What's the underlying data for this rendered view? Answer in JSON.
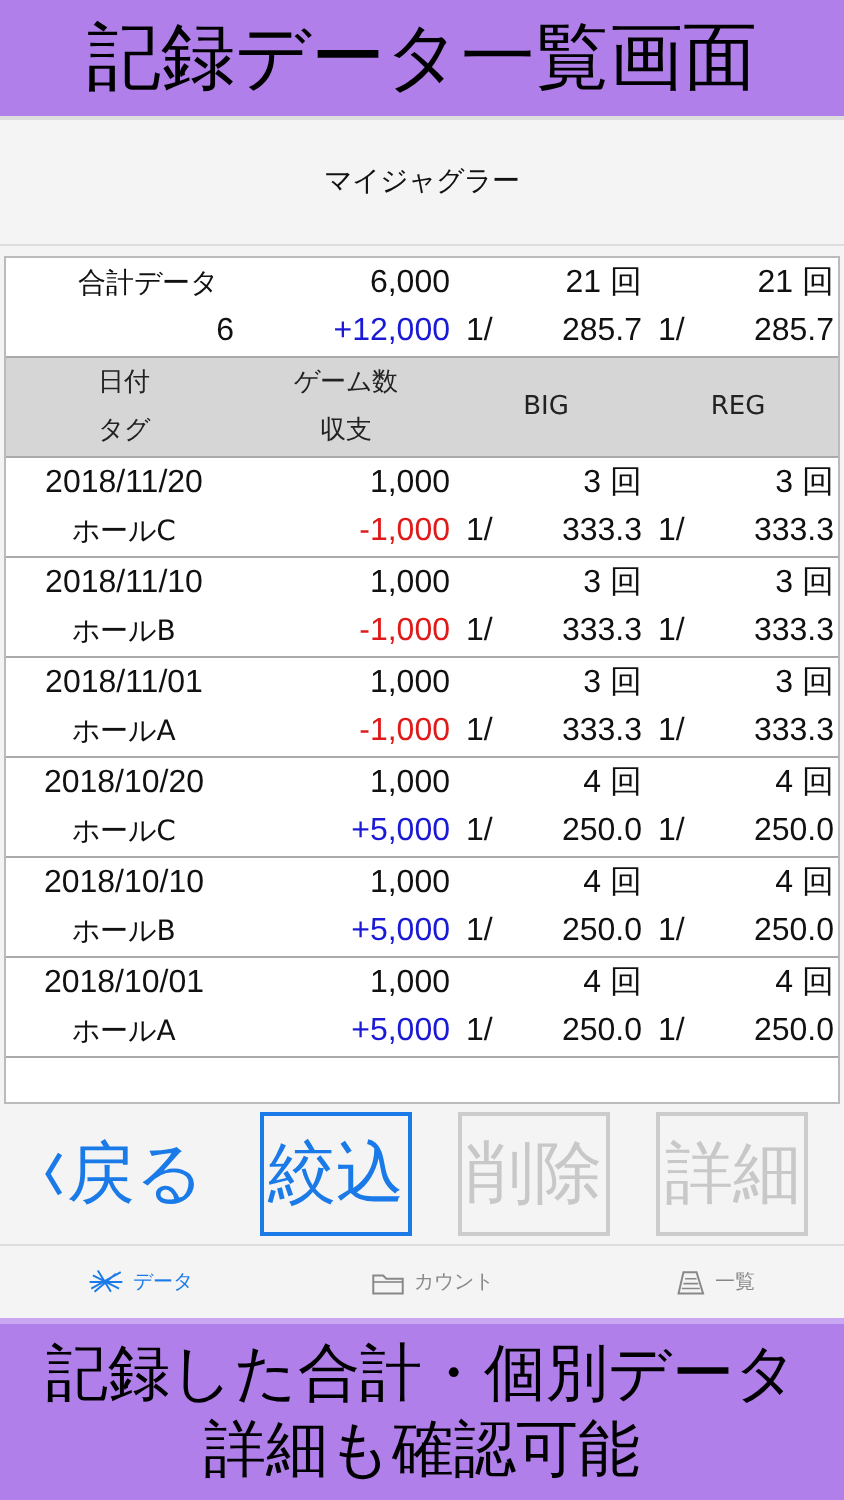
{
  "top_banner": "記録データ一覧画面",
  "nav": {
    "title": "マイジャグラー"
  },
  "summary": {
    "label": "合計データ",
    "count": "6",
    "games": "6,000",
    "balance": "+12,000",
    "color": "#1a1ad6",
    "big": {
      "count": "21 回",
      "prefix": "1/",
      "rate": "285.7"
    },
    "reg": {
      "count": "21 回",
      "prefix": "1/",
      "rate": "285.7"
    }
  },
  "columns": [
    {
      "top": "日付",
      "bottom": "タグ"
    },
    {
      "top": "ゲーム数",
      "bottom": "収支"
    },
    {
      "top": "BIG"
    },
    {
      "top": "REG"
    }
  ],
  "rows": [
    {
      "date": "2018/11/20",
      "tag": "ホールC",
      "games": "1,000",
      "balance": "-1,000",
      "color": "#e01a1a",
      "big": {
        "count": "3 回",
        "prefix": "1/",
        "rate": "333.3"
      },
      "reg": {
        "count": "3 回",
        "prefix": "1/",
        "rate": "333.3"
      }
    },
    {
      "date": "2018/11/10",
      "tag": "ホールB",
      "games": "1,000",
      "balance": "-1,000",
      "color": "#e01a1a",
      "big": {
        "count": "3 回",
        "prefix": "1/",
        "rate": "333.3"
      },
      "reg": {
        "count": "3 回",
        "prefix": "1/",
        "rate": "333.3"
      }
    },
    {
      "date": "2018/11/01",
      "tag": "ホールA",
      "games": "1,000",
      "balance": "-1,000",
      "color": "#e01a1a",
      "big": {
        "count": "3 回",
        "prefix": "1/",
        "rate": "333.3"
      },
      "reg": {
        "count": "3 回",
        "prefix": "1/",
        "rate": "333.3"
      }
    },
    {
      "date": "2018/10/20",
      "tag": "ホールC",
      "games": "1,000",
      "balance": "+5,000",
      "color": "#1a1ad6",
      "big": {
        "count": "4 回",
        "prefix": "1/",
        "rate": "250.0"
      },
      "reg": {
        "count": "4 回",
        "prefix": "1/",
        "rate": "250.0"
      }
    },
    {
      "date": "2018/10/10",
      "tag": "ホールB",
      "games": "1,000",
      "balance": "+5,000",
      "color": "#1a1ad6",
      "big": {
        "count": "4 回",
        "prefix": "1/",
        "rate": "250.0"
      },
      "reg": {
        "count": "4 回",
        "prefix": "1/",
        "rate": "250.0"
      }
    },
    {
      "date": "2018/10/01",
      "tag": "ホールA",
      "games": "1,000",
      "balance": "+5,000",
      "color": "#1a1ad6",
      "big": {
        "count": "4 回",
        "prefix": "1/",
        "rate": "250.0"
      },
      "reg": {
        "count": "4 回",
        "prefix": "1/",
        "rate": "250.0"
      }
    }
  ],
  "buttons": [
    {
      "label": "戻る",
      "kind": "back",
      "selected": false,
      "disabled": false
    },
    {
      "label": "絞込",
      "kind": "boxed",
      "selected": true,
      "disabled": false
    },
    {
      "label": "削除",
      "kind": "boxed",
      "selected": false,
      "disabled": true
    },
    {
      "label": "詳細",
      "kind": "boxed",
      "selected": false,
      "disabled": true
    }
  ],
  "tabs": [
    {
      "label": "データ",
      "kind": "data",
      "selected": true
    },
    {
      "label": "カウント",
      "kind": "count",
      "selected": false
    },
    {
      "label": "一覧",
      "kind": "list",
      "selected": false
    }
  ],
  "bottom_banner": [
    "記録した合計・個別データ",
    "詳細も確認可能"
  ]
}
